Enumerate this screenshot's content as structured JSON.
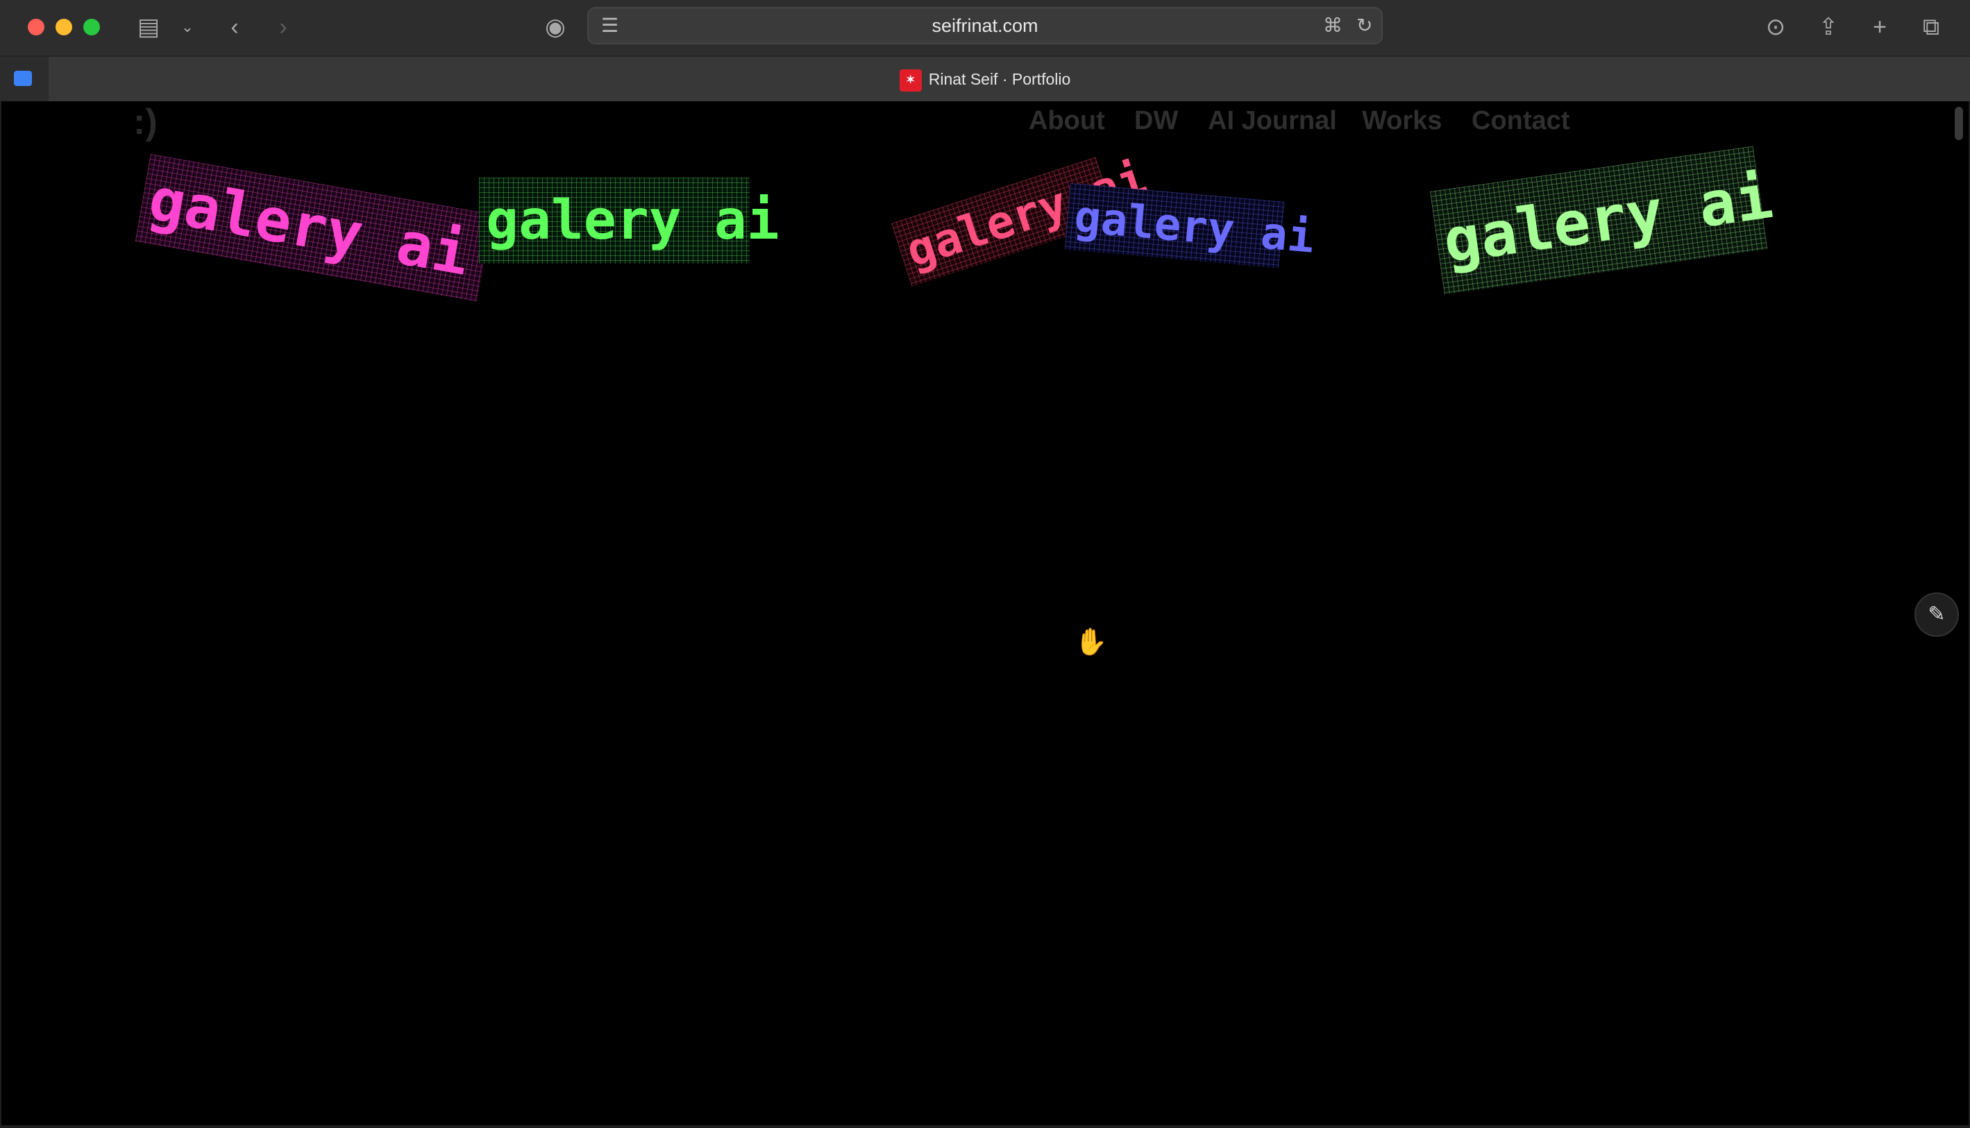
{
  "browser": {
    "url": "seifrinat.com",
    "tab_title": "Rinat Seif · Portfolio",
    "icons": {
      "sidebar": "sidebar-icon",
      "back": "chevron-left-icon",
      "forward": "chevron-right-icon",
      "password": "password-icon",
      "reader": "reader-icon",
      "translate": "translate-icon",
      "reload": "reload-icon",
      "download": "download-icon",
      "share": "share-icon",
      "new_tab": "plus-icon",
      "tab_overview": "tabs-overview-icon"
    }
  },
  "page": {
    "logo": ":)",
    "nav": [
      "About",
      "DW",
      "AI Journal",
      "Works",
      "Contact"
    ],
    "stickers": [
      {
        "text": "galery ai",
        "color": "#ff44d0"
      },
      {
        "text": "galery ai",
        "color": "#5cff5a"
      },
      {
        "text": "galery ai",
        "color": "#ff4f7f"
      },
      {
        "text": "galery ai",
        "color": "#6a6bff"
      },
      {
        "text": "galery ai",
        "color": "#a6ff95"
      }
    ],
    "edit_icon": "pencil-icon",
    "cursor_icon": "hand-cursor-icon"
  }
}
